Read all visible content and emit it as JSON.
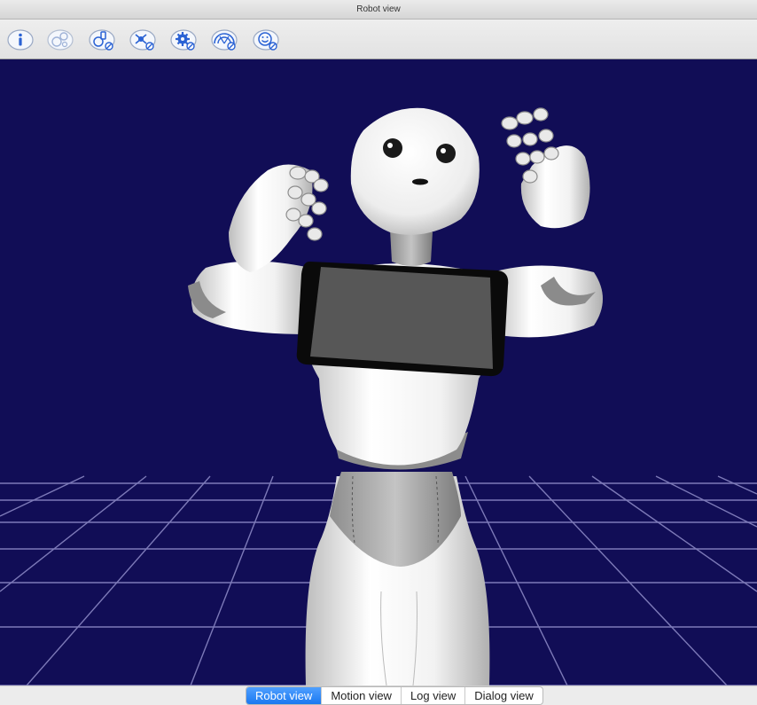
{
  "window": {
    "title": "Robot view"
  },
  "toolbar": {
    "tools": [
      {
        "icon": "info-icon"
      },
      {
        "icon": "bubbles-icon"
      },
      {
        "icon": "joints-disabled-icon"
      },
      {
        "icon": "sensors-disabled-icon"
      },
      {
        "icon": "settings-disabled-icon"
      },
      {
        "icon": "sonar-disabled-icon"
      },
      {
        "icon": "face-disabled-icon"
      }
    ]
  },
  "tabs": {
    "robot_view": "Robot view",
    "motion_view": "Motion view",
    "log_view": "Log view",
    "dialog_view": "Dialog view",
    "active": "Robot view"
  },
  "colors": {
    "viewport_background": "#110d56",
    "grid": "#7d7ab8",
    "tab_active": "#1a78f0",
    "icon_blue": "#2a62d4"
  }
}
